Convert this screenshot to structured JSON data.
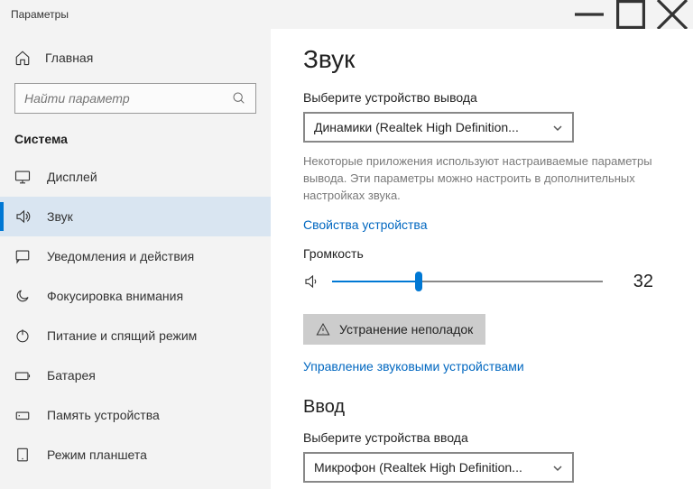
{
  "window": {
    "title": "Параметры"
  },
  "sidebar": {
    "home": "Главная",
    "search_placeholder": "Найти параметр",
    "section": "Система",
    "items": [
      {
        "label": "Дисплей"
      },
      {
        "label": "Звук"
      },
      {
        "label": "Уведомления и действия"
      },
      {
        "label": "Фокусировка внимания"
      },
      {
        "label": "Питание и спящий режим"
      },
      {
        "label": "Батарея"
      },
      {
        "label": "Память устройства"
      },
      {
        "label": "Режим планшета"
      }
    ]
  },
  "main": {
    "title": "Звук",
    "output_label": "Выберите устройство вывода",
    "output_device": "Динамики (Realtek High Definition...",
    "output_info": "Некоторые приложения используют настраиваемые параметры вывода. Эти параметры можно настроить в дополнительных настройках звука.",
    "device_props": "Свойства устройства",
    "volume_label": "Громкость",
    "volume_value": "32",
    "troubleshoot": "Устранение неполадок",
    "manage_devices": "Управление звуковыми устройствами",
    "input_heading": "Ввод",
    "input_label": "Выберите устройства ввода",
    "input_device": "Микрофон (Realtek High Definition..."
  }
}
